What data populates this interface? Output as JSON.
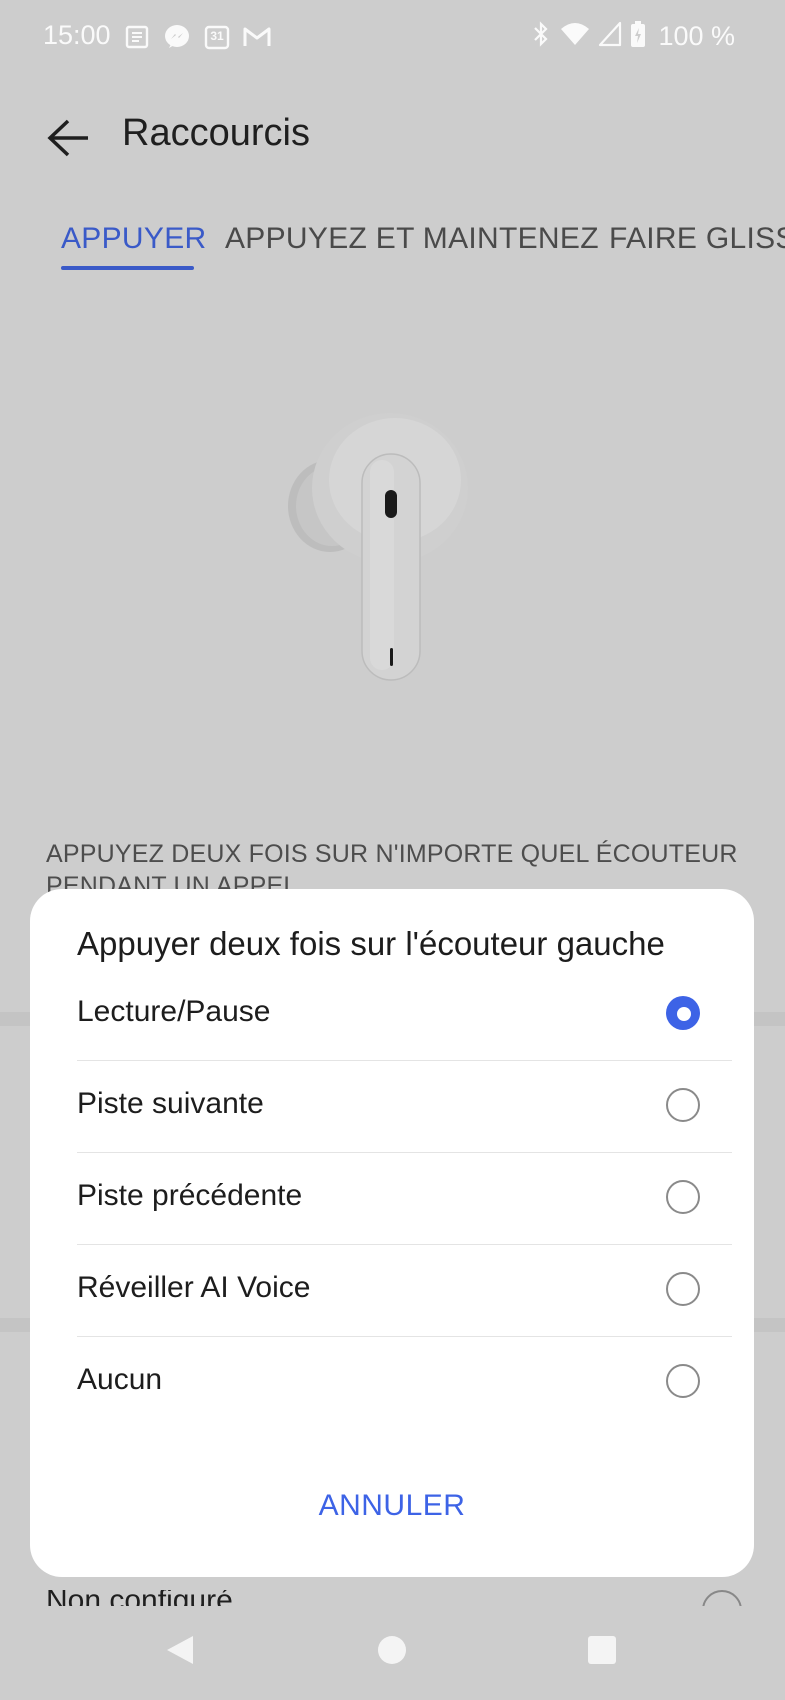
{
  "status_bar": {
    "time": "15:00",
    "left_icons": [
      "news-icon",
      "messenger-icon",
      "calendar-icon",
      "gmail-icon"
    ],
    "calendar_day": "31",
    "right_icons": [
      "bluetooth-icon",
      "wifi-icon",
      "signal-icon",
      "battery-charging-icon"
    ],
    "battery_text": "100 %"
  },
  "appbar": {
    "title": "Raccourcis"
  },
  "tabs": [
    {
      "label": "APPUYER",
      "active": true
    },
    {
      "label": "APPUYEZ ET MAINTENEZ",
      "active": false
    },
    {
      "label": "FAIRE GLISSER",
      "active": false
    }
  ],
  "section": {
    "text": "APPUYEZ DEUX FOIS SUR N'IMPORTE QUEL ÉCOUTEUR PENDANT UN APPEL"
  },
  "peek": {
    "text": "Non configuré"
  },
  "dialog": {
    "title": "Appuyer deux fois sur l'écouteur gauche",
    "options": [
      {
        "label": "Lecture/Pause",
        "selected": true
      },
      {
        "label": "Piste suivante",
        "selected": false
      },
      {
        "label": "Piste précédente",
        "selected": false
      },
      {
        "label": "Réveiller AI Voice",
        "selected": false
      },
      {
        "label": "Aucun",
        "selected": false
      }
    ],
    "cancel_label": "ANNULER"
  },
  "colors": {
    "scrim_background": "#cdcdcd",
    "accent": "#3d63e6",
    "tab_accent": "#3a5ac8",
    "dialog_background": "#ffffff"
  },
  "navbar": {
    "icons": [
      "back-icon",
      "home-icon",
      "recents-icon"
    ]
  }
}
